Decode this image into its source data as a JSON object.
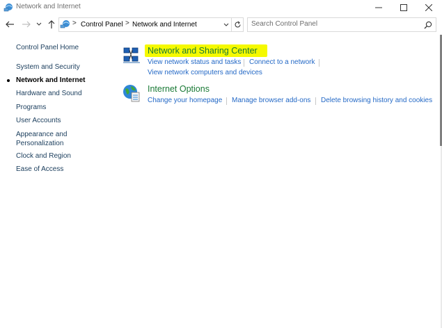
{
  "window": {
    "title": "Network and Internet",
    "minimize_glyph": "—",
    "maximize_glyph": "☐",
    "close_glyph": "✕"
  },
  "address": {
    "breadcrumb": [
      "Control Panel",
      "Network and Internet"
    ],
    "separator": ">",
    "search_placeholder": "Search Control Panel"
  },
  "leftnav": {
    "items": [
      {
        "label": "Control Panel Home"
      },
      {
        "label": "System and Security"
      },
      {
        "label": "Network and Internet",
        "active": true
      },
      {
        "label": "Hardware and Sound"
      },
      {
        "label": "Programs"
      },
      {
        "label": "User Accounts"
      },
      {
        "label": "Appearance and"
      },
      {
        "label": "Personalization"
      },
      {
        "label": "Clock and Region"
      },
      {
        "label": "Ease of Access"
      }
    ]
  },
  "categories": [
    {
      "title": "Network and Sharing Center",
      "icon": "network-sharing-icon",
      "highlighted": true,
      "tasks": [
        "View network status and tasks",
        "Connect to a network",
        "View network computers and devices"
      ]
    },
    {
      "title": "Internet Options",
      "icon": "internet-options-icon",
      "tasks": [
        "Change your homepage",
        "Manage browser add-ons",
        "Delete browsing history and cookies"
      ]
    }
  ],
  "colors": {
    "category_title": "#1a7a36",
    "task_link": "#2469c6",
    "highlight": "#f5f900",
    "nav_text": "#1a3d5c"
  }
}
